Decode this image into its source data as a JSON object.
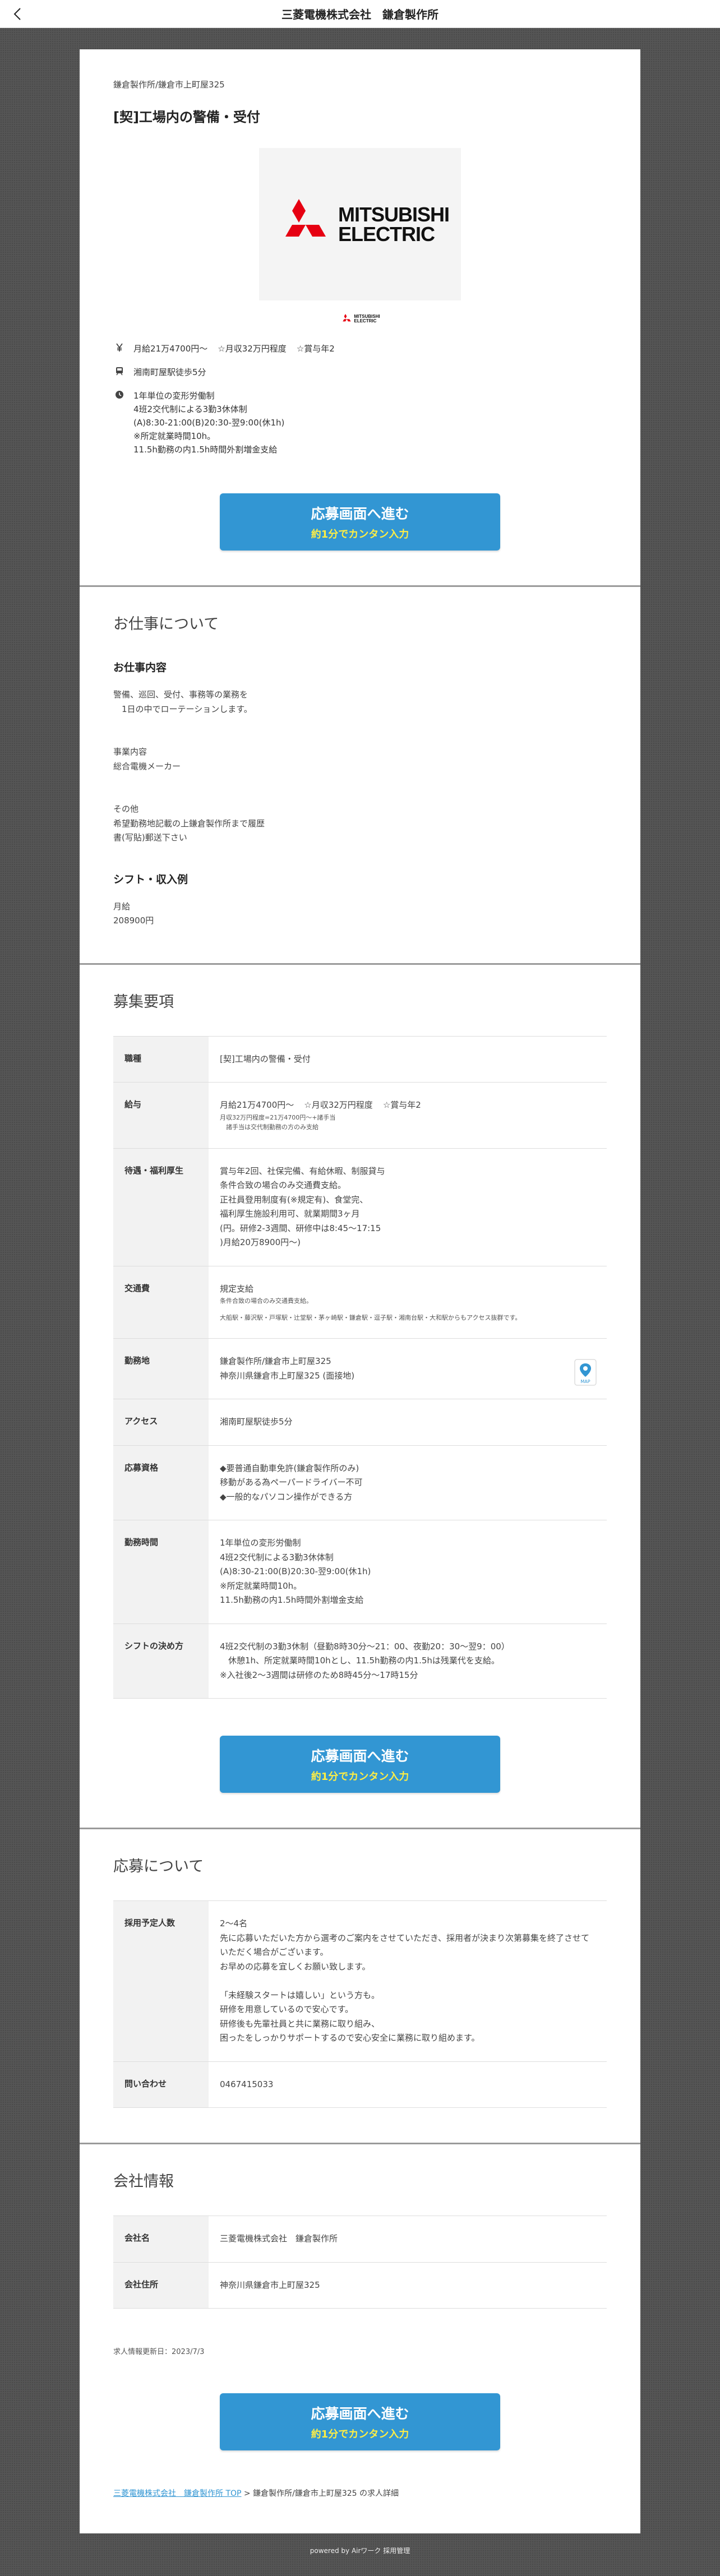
{
  "topbar": {
    "title": "三菱電機株式会社　鎌倉製作所"
  },
  "job": {
    "location": "鎌倉製作所/鎌倉市上町屋325",
    "title": "[契]工場内の警備・受付",
    "logo_text_line1": "MITSUBISHI",
    "logo_text_line2": "ELECTRIC"
  },
  "summary": {
    "salary_main": "月給21万4700円〜",
    "salary_annual": "☆月収32万円程度",
    "salary_bonus": "☆賞与年2",
    "access": "湘南町屋駅徒歩5分",
    "hours": "1年単位の変形労働制\n4班2交代制による3勤3休体制\n(A)8:30-21:00(B)20:30-翌9:00(休1h)\n※所定就業時間10h。\n11.5h勤務の内1.5h時間外割増金支給"
  },
  "apply_button": {
    "main": "応募画面へ進む",
    "sub": "約1分でカンタン入力"
  },
  "work": {
    "title": "お仕事について",
    "content_title": "お仕事内容",
    "content_text": "警備、巡回、受付、事務等の業務を\n　1日の中でローテーションします。\n\n\n事業内容\n総合電機メーカー\n\n\nその他\n希望勤務地記載の上鎌倉製作所まで履歴\n書(写貼)郵送下さい",
    "shift_title": "シフト・収入例",
    "shift_text": "月給\n208900円"
  },
  "recruit": {
    "title": "募集要項",
    "rows": {
      "role_label": "職種",
      "role_value": "[契]工場内の警備・受付",
      "salary_label": "給与",
      "salary_main": "月給21万4700円〜",
      "salary_annual": "☆月収32万円程度",
      "salary_bonus": "☆賞与年2",
      "salary_note": "月収32万円程度=21万4700円〜+諸手当\n　諸手当は交代制勤務の方のみ支給",
      "benefit_label": "待遇・福利厚生",
      "benefit_value": "賞与年2回、社保完備、有給休暇、制服貸与\n条件合致の場合のみ交通費支給。\n正社員登用制度有(※規定有)、食堂完、\n福利厚生施設利用可、就業期間3ヶ月\n(円。研修2-3週間、研修中は8:45〜17:15\n)月給20万8900円〜)",
      "transport_label": "交通費",
      "transport_main": "規定支給",
      "transport_note": "条件合致の場合のみ交通費支給。",
      "transport_stations": "大船駅・藤沢駅・戸塚駅・辻堂駅・茅ヶ崎駅・鎌倉駅・逗子駅・湘南台駅・大和駅からもアクセス抜群です。",
      "place_label": "勤務地",
      "place_line1": "鎌倉製作所/鎌倉市上町屋325",
      "place_line2": "神奈川県鎌倉市上町屋325 (面接地)",
      "map_label": "MAP",
      "access_label": "アクセス",
      "access_value": "湘南町屋駅徒歩5分",
      "qual_label": "応募資格",
      "qual_value": "◆要普通自動車免許(鎌倉製作所のみ)\n移動がある為ペーパードライバー不可\n◆一般的なパソコン操作ができる方",
      "hours_label": "勤務時間",
      "hours_value": "1年単位の変形労働制\n4班2交代制による3勤3休体制\n(A)8:30-21:00(B)20:30-翌9:00(休1h)\n※所定就業時間10h。\n11.5h勤務の内1.5h時間外割増金支給",
      "shift_label": "シフトの決め方",
      "shift_value": "4班2交代制の3勤3休制（昼勤8時30分〜21：00、夜勤20：30〜翌9：00）\n　休憩1h、所定就業時間10hとし、11.5h勤務の内1.5hは残業代を支給。\n※入社後2〜3週間は研修のため8時45分〜17時15分"
    }
  },
  "apply_info": {
    "title": "応募について",
    "plan_label": "採用予定人数",
    "plan_value": "2〜4名\n先に応募いただいた方から選考のご案内をさせていただき、採用者が決まり次第募集を終了させていただく場合がございます。\nお早めの応募を宜しくお願い致します。\n\n「未経験スタートは嬉しい」という方も。\n研修を用意しているので安心です。\n研修後も先輩社員と共に業務に取り組み、\n困ったをしっかりサポートするので安心安全に業務に取り組めます。",
    "contact_label": "問い合わせ",
    "contact_value": "0467415033"
  },
  "company": {
    "title": "会社情報",
    "name_label": "会社名",
    "name_value": "三菱電機株式会社　鎌倉製作所",
    "address_label": "会社住所",
    "address_value": "神奈川県鎌倉市上町屋325",
    "updated": "求人情報更新日：2023/7/3"
  },
  "breadcrumb": {
    "link": "三菱電機株式会社　鎌倉製作所 TOP",
    "separator": " > ",
    "current": "鎌倉製作所/鎌倉市上町屋325 の求人詳細"
  },
  "footer": {
    "text": "powered by Airワーク 採用管理"
  },
  "colors": {
    "accent": "#3296d3",
    "button_sub": "#ffee44",
    "logo_red": "#e60012"
  }
}
